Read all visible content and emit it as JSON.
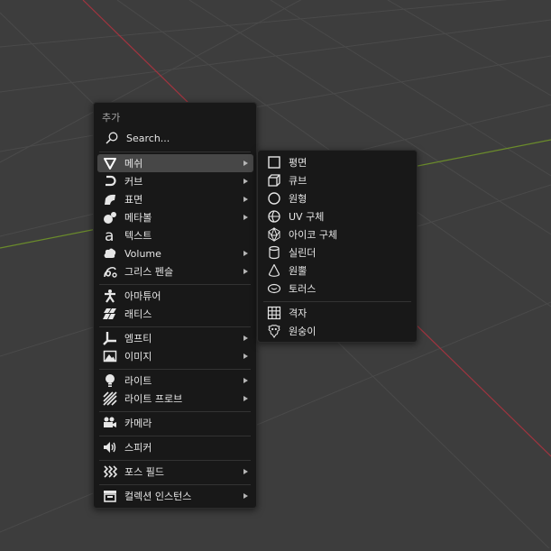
{
  "menu": {
    "title": "추가",
    "search_label": "Search...",
    "items": [
      {
        "label": "메쉬",
        "icon": "mesh-icon",
        "submenu": true,
        "active": true
      },
      {
        "label": "커브",
        "icon": "curve-icon",
        "submenu": true
      },
      {
        "label": "표면",
        "icon": "surface-icon",
        "submenu": true
      },
      {
        "label": "메타볼",
        "icon": "metaball-icon",
        "submenu": true
      },
      {
        "label": "텍스트",
        "icon": "text-icon",
        "submenu": false
      },
      {
        "label": "Volume",
        "icon": "volume-icon",
        "submenu": true
      },
      {
        "label": "그리스 펜슬",
        "icon": "grease-pencil-icon",
        "submenu": true
      },
      {
        "label": "아마튜어",
        "icon": "armature-icon",
        "submenu": false
      },
      {
        "label": "래티스",
        "icon": "lattice-icon",
        "submenu": false
      },
      {
        "label": "엠프티",
        "icon": "empty-icon",
        "submenu": true
      },
      {
        "label": "이미지",
        "icon": "image-icon",
        "submenu": true
      },
      {
        "label": "라이트",
        "icon": "light-icon",
        "submenu": true
      },
      {
        "label": "라이트 프로브",
        "icon": "light-probe-icon",
        "submenu": true
      },
      {
        "label": "카메라",
        "icon": "camera-icon",
        "submenu": false
      },
      {
        "label": "스피커",
        "icon": "speaker-icon",
        "submenu": false
      },
      {
        "label": "포스 필드",
        "icon": "force-field-icon",
        "submenu": true
      },
      {
        "label": "컬렉션 인스턴스",
        "icon": "collection-instance-icon",
        "submenu": true
      }
    ]
  },
  "submenu": {
    "items": [
      {
        "label": "평면",
        "icon": "plane-icon"
      },
      {
        "label": "큐브",
        "icon": "cube-icon"
      },
      {
        "label": "원형",
        "icon": "circle-icon"
      },
      {
        "label": "UV 구체",
        "icon": "uv-sphere-icon"
      },
      {
        "label": "아이코 구체",
        "icon": "ico-sphere-icon"
      },
      {
        "label": "실린더",
        "icon": "cylinder-icon"
      },
      {
        "label": "원뿔",
        "icon": "cone-icon"
      },
      {
        "label": "토러스",
        "icon": "torus-icon"
      },
      {
        "label": "격자",
        "icon": "grid-icon"
      },
      {
        "label": "원숭이",
        "icon": "monkey-icon"
      }
    ]
  },
  "colors": {
    "viewport_bg": "#3d3d3d",
    "grid_line": "#4a4a4a",
    "x_axis": "#a0343f",
    "y_axis": "#6b8c2b",
    "menu_bg": "#181818",
    "highlight": "#474747"
  }
}
